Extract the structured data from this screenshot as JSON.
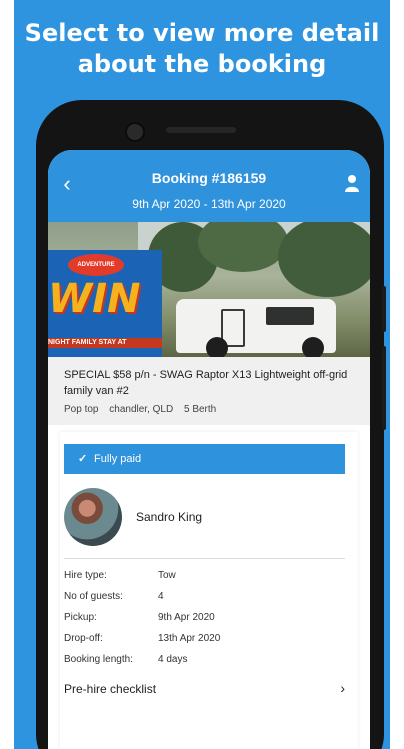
{
  "headline": [
    "Select to view more detail",
    "about the booking"
  ],
  "header": {
    "title": "Booking #186159",
    "dates": "9th Apr 2020 - 13th Apr 2020",
    "back_icon": "chevron-left-icon",
    "user_icon": "user-icon"
  },
  "promo": {
    "brand": "ADVENTURE",
    "word": "WIN",
    "line": "NIGHT FAMILY STAY AT"
  },
  "listing": {
    "title": "SPECIAL $58 p/n - SWAG Raptor X13 Lightweight off-grid family van #2",
    "type": "Pop top",
    "location": "chandler, QLD",
    "berth": "5 Berth"
  },
  "status": {
    "check": "✓",
    "label": "Fully paid",
    "color": "#2f92dd"
  },
  "owner": {
    "name": "Sandro King"
  },
  "details": [
    {
      "label": "Hire type:",
      "value": "Tow"
    },
    {
      "label": "No of guests:",
      "value": "4"
    },
    {
      "label": "Pickup:",
      "value": "9th Apr 2020"
    },
    {
      "label": "Drop-off:",
      "value": "13th Apr 2020"
    },
    {
      "label": "Booking length:",
      "value": "4 days"
    }
  ],
  "checklist": {
    "label": "Pre-hire checklist",
    "chevron": "›"
  },
  "colors": {
    "brand_blue": "#2e94e0"
  }
}
